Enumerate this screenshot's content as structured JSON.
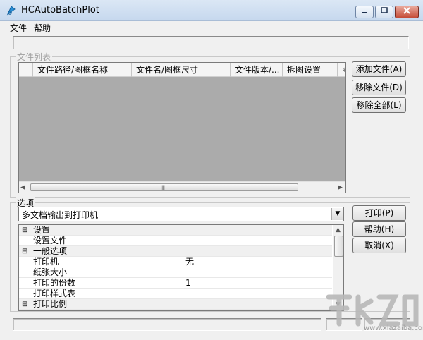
{
  "window": {
    "title": "HCAutoBatchPlot"
  },
  "menu": {
    "file": "文件",
    "help": "帮助"
  },
  "file_list": {
    "legend": "文件列表",
    "columns": [
      "文件路径/图框名称",
      "文件名/图框尺寸",
      "文件版本/...",
      "拆图设置",
      "图"
    ]
  },
  "file_buttons": {
    "add": "添加文件(A)",
    "remove": "移除文件(D)",
    "remove_all": "移除全部(L)"
  },
  "options": {
    "legend": "选项",
    "output_mode": "多文档输出到打印机",
    "properties": [
      {
        "type": "category",
        "mark": "⊟",
        "name": "设置",
        "value": ""
      },
      {
        "type": "item",
        "mark": "",
        "name": "设置文件",
        "value": ""
      },
      {
        "type": "category",
        "mark": "⊟",
        "name": "一般选项",
        "value": ""
      },
      {
        "type": "item",
        "mark": "",
        "name": "打印机",
        "value": "无"
      },
      {
        "type": "item",
        "mark": "",
        "name": "纸张大小",
        "value": ""
      },
      {
        "type": "item",
        "mark": "",
        "name": "打印的份数",
        "value": "1"
      },
      {
        "type": "item",
        "mark": "",
        "name": "打印样式表",
        "value": ""
      },
      {
        "type": "category",
        "mark": "⊟",
        "name": "打印比例",
        "value": ""
      }
    ]
  },
  "action_buttons": {
    "print": "打印(P)",
    "help": "帮助(H)",
    "cancel": "取消(X)"
  },
  "watermark": {
    "url": "www.xiazaiba.com"
  },
  "colors": {
    "list_background": "#ababab",
    "title_bar": "#c6d8ee",
    "close_button": "#c54b36"
  }
}
